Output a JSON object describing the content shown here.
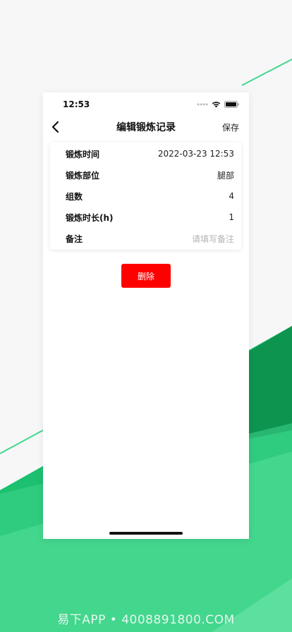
{
  "colors": {
    "accent_green": "#1fbf70",
    "dark_green": "#0f9a55",
    "light_green": "#4fdc95",
    "delete_red": "#ff0000"
  },
  "status_bar": {
    "time": "12:53",
    "icons": [
      "signal-dots-icon",
      "wifi-icon",
      "battery-icon"
    ]
  },
  "nav": {
    "back_icon": "chevron-left-icon",
    "title": "编辑锻炼记录",
    "save_label": "保存"
  },
  "form": {
    "rows": [
      {
        "label": "锻炼时间",
        "value": "2022-03-23 12:53"
      },
      {
        "label": "锻炼部位",
        "value": "腿部"
      },
      {
        "label": "组数",
        "value": "4"
      },
      {
        "label": "锻炼时长(h)",
        "value": "1"
      },
      {
        "label": "备注",
        "placeholder": "请填写备注"
      }
    ]
  },
  "delete_label": "删除",
  "watermark": "易下APP • 4008891800.COM"
}
